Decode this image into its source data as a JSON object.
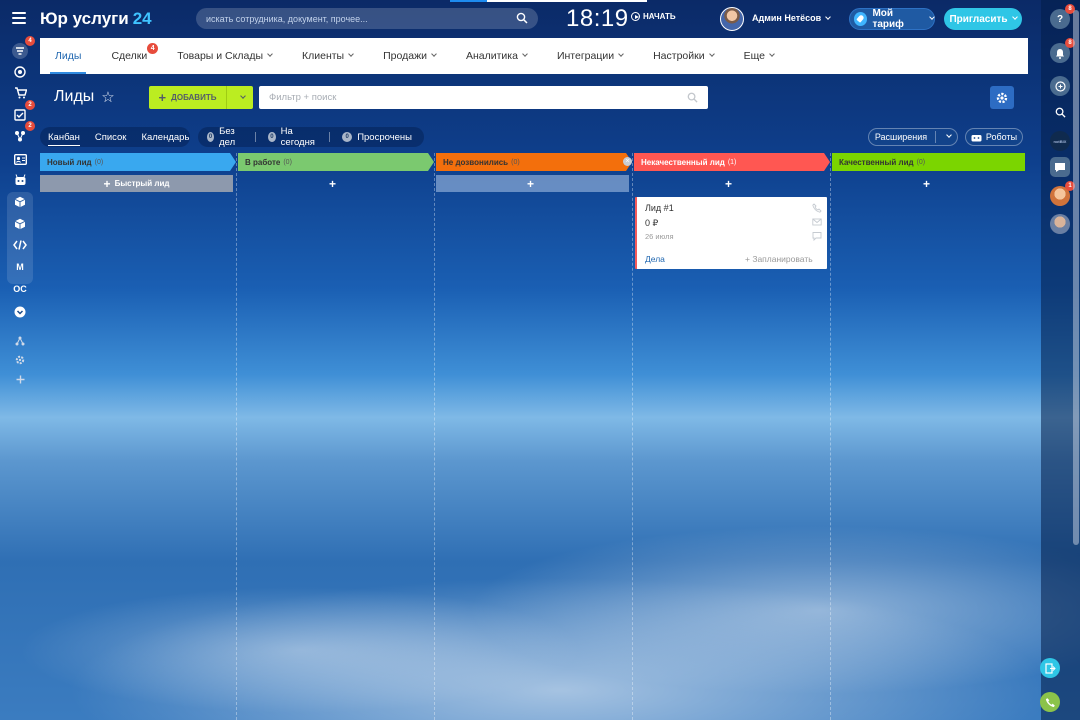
{
  "app": {
    "brand": "Юр услуги",
    "brand_num": "24",
    "search_placeholder": "искать сотрудника, документ, прочее...",
    "time": "18:19",
    "start_label": "НАЧАТЬ",
    "user_name": "Админ Нетёсов",
    "tariff_label": "Мой тариф",
    "invite_label": "Пригласить"
  },
  "sidebar": {
    "items": [
      {
        "name": "menu-filter-icon",
        "badge": "4"
      },
      {
        "name": "target-icon",
        "badge": ""
      },
      {
        "name": "cart-icon",
        "badge": ""
      },
      {
        "name": "tasks-icon",
        "badge": "2"
      },
      {
        "name": "network-icon",
        "badge": "2"
      },
      {
        "name": "contact-card-icon",
        "badge": ""
      },
      {
        "name": "robot-icon",
        "badge": ""
      },
      {
        "name": "box-icon",
        "badge": ""
      },
      {
        "name": "package-icon",
        "badge": ""
      },
      {
        "name": "code-icon",
        "badge": ""
      },
      {
        "name": "m-icon",
        "badge": ""
      },
      {
        "name": "oc-icon",
        "badge": ""
      },
      {
        "name": "chevron-down-circle-icon",
        "badge": ""
      },
      {
        "name": "structure-icon",
        "badge": ""
      },
      {
        "name": "gear-icon",
        "badge": ""
      },
      {
        "name": "plus-icon",
        "badge": ""
      }
    ],
    "m_label": "M",
    "oc_label": "OC"
  },
  "right_panel": {
    "help_badge": "8",
    "bell_badge": "8",
    "avatar1_label": "notBIX",
    "avatar2_badge": "1"
  },
  "nav": {
    "items": [
      {
        "label": "Лиды",
        "active": true,
        "chevron": false,
        "badge": ""
      },
      {
        "label": "Сделки",
        "active": false,
        "chevron": false,
        "badge": "4"
      },
      {
        "label": "Товары и Склады",
        "active": false,
        "chevron": true,
        "badge": ""
      },
      {
        "label": "Клиенты",
        "active": false,
        "chevron": true,
        "badge": ""
      },
      {
        "label": "Продажи",
        "active": false,
        "chevron": true,
        "badge": ""
      },
      {
        "label": "Аналитика",
        "active": false,
        "chevron": true,
        "badge": ""
      },
      {
        "label": "Интеграции",
        "active": false,
        "chevron": true,
        "badge": ""
      },
      {
        "label": "Настройки",
        "active": false,
        "chevron": true,
        "badge": ""
      },
      {
        "label": "Еще",
        "active": false,
        "chevron": true,
        "badge": ""
      }
    ]
  },
  "page": {
    "title": "Лиды",
    "add_label": "ДОБАВИТЬ",
    "filter_placeholder": "Фильтр + поиск"
  },
  "views": {
    "tabs": [
      "Канбан",
      "Список",
      "Календарь"
    ],
    "active": "Канбан"
  },
  "counters": [
    {
      "count": "0",
      "label": "Без дел"
    },
    {
      "count": "0",
      "label": "На сегодня"
    },
    {
      "count": "0",
      "label": "Просрочены"
    }
  ],
  "toolbar": {
    "extensions_label": "Расширения",
    "robots_label": "Роботы"
  },
  "kanban": {
    "quick_lead_label": "Быстрый лид",
    "columns": [
      {
        "title": "Новый лид",
        "count": "(0)",
        "color": "#39a8ef"
      },
      {
        "title": "В работе",
        "count": "(0)",
        "color": "#7bc96f"
      },
      {
        "title": "Не дозвонились",
        "count": "(0)",
        "color": "#f36f0c"
      },
      {
        "title": "Некачественный лид",
        "count": "(1)",
        "color": "#ff5752"
      },
      {
        "title": "Качественный лид",
        "count": "(0)",
        "color": "#7bd500"
      }
    ],
    "card": {
      "title": "Лид #1",
      "price": "0 ₽",
      "date": "26 июля",
      "deals_label": "Дела",
      "plan_label": "+ Запланировать"
    }
  }
}
